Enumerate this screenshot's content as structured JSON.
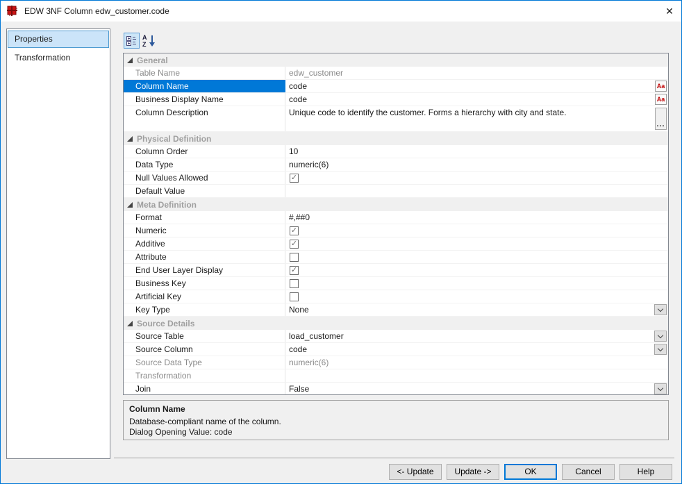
{
  "window": {
    "title": "EDW 3NF Column edw_customer.code",
    "close_glyph": "✕"
  },
  "sidebar": {
    "items": [
      {
        "label": "Properties",
        "selected": true
      },
      {
        "label": "Transformation",
        "selected": false
      }
    ]
  },
  "toolbar": {
    "categorized_icon": "categorized-view-icon",
    "alphabetical_icon": "alphabetical-sort-icon"
  },
  "glyphs": {
    "check": "✓",
    "case_icon": "Aa",
    "ellipsis_icon": "...",
    "expanded_triangle": "triangle"
  },
  "colors": {
    "selection": "#0078d7",
    "dialog_border": "#0078d7",
    "category_text": "#9f9f9f",
    "case_icon_red": "#c00000"
  },
  "grid": {
    "sections": [
      {
        "title": "General",
        "rows": [
          {
            "label": "Table Name",
            "value": "edw_customer",
            "control": "text",
            "disabled": true
          },
          {
            "label": "Column Name",
            "value": "code",
            "control": "text",
            "selected": true,
            "right_icon": "case"
          },
          {
            "label": "Business Display Name",
            "value": "code",
            "control": "text",
            "right_icon": "case"
          },
          {
            "label": "Column Description",
            "value": "Unique code to identify the customer. Forms a hierarchy with city and state.",
            "control": "multiline",
            "right_icon": "ellipsis"
          }
        ]
      },
      {
        "title": "Physical Definition",
        "rows": [
          {
            "label": "Column Order",
            "value": "10",
            "control": "text"
          },
          {
            "label": "Data Type",
            "value": "numeric(6)",
            "control": "text"
          },
          {
            "label": "Null Values Allowed",
            "control": "checkbox",
            "checked": true
          },
          {
            "label": "Default Value",
            "value": "",
            "control": "text"
          }
        ]
      },
      {
        "title": "Meta Definition",
        "rows": [
          {
            "label": "Format",
            "value": "#,##0",
            "control": "text"
          },
          {
            "label": "Numeric",
            "control": "checkbox",
            "checked": true
          },
          {
            "label": "Additive",
            "control": "checkbox",
            "checked": true
          },
          {
            "label": "Attribute",
            "control": "checkbox",
            "checked": false
          },
          {
            "label": "End User Layer Display",
            "control": "checkbox",
            "checked": true
          },
          {
            "label": "Business Key",
            "control": "checkbox",
            "checked": false
          },
          {
            "label": "Artificial Key",
            "control": "checkbox",
            "checked": false
          },
          {
            "label": "Key Type",
            "value": "None",
            "control": "dropdown"
          }
        ]
      },
      {
        "title": "Source Details",
        "rows": [
          {
            "label": "Source Table",
            "value": "load_customer",
            "control": "dropdown"
          },
          {
            "label": "Source Column",
            "value": "code",
            "control": "dropdown"
          },
          {
            "label": "Source Data Type",
            "value": "numeric(6)",
            "control": "text",
            "disabled": true
          },
          {
            "label": "Transformation",
            "value": "",
            "control": "text",
            "disabled": true
          },
          {
            "label": "Join",
            "value": "False",
            "control": "dropdown"
          }
        ]
      }
    ]
  },
  "help_panel": {
    "title": "Column Name",
    "lines": [
      "Database-compliant name of the column.",
      "Dialog Opening Value: code"
    ]
  },
  "footer": {
    "buttons": [
      {
        "label": "<- Update",
        "default": false
      },
      {
        "label": "Update ->",
        "default": false
      },
      {
        "label": "OK",
        "default": true
      },
      {
        "label": "Cancel",
        "default": false
      },
      {
        "label": "Help",
        "default": false
      }
    ]
  }
}
